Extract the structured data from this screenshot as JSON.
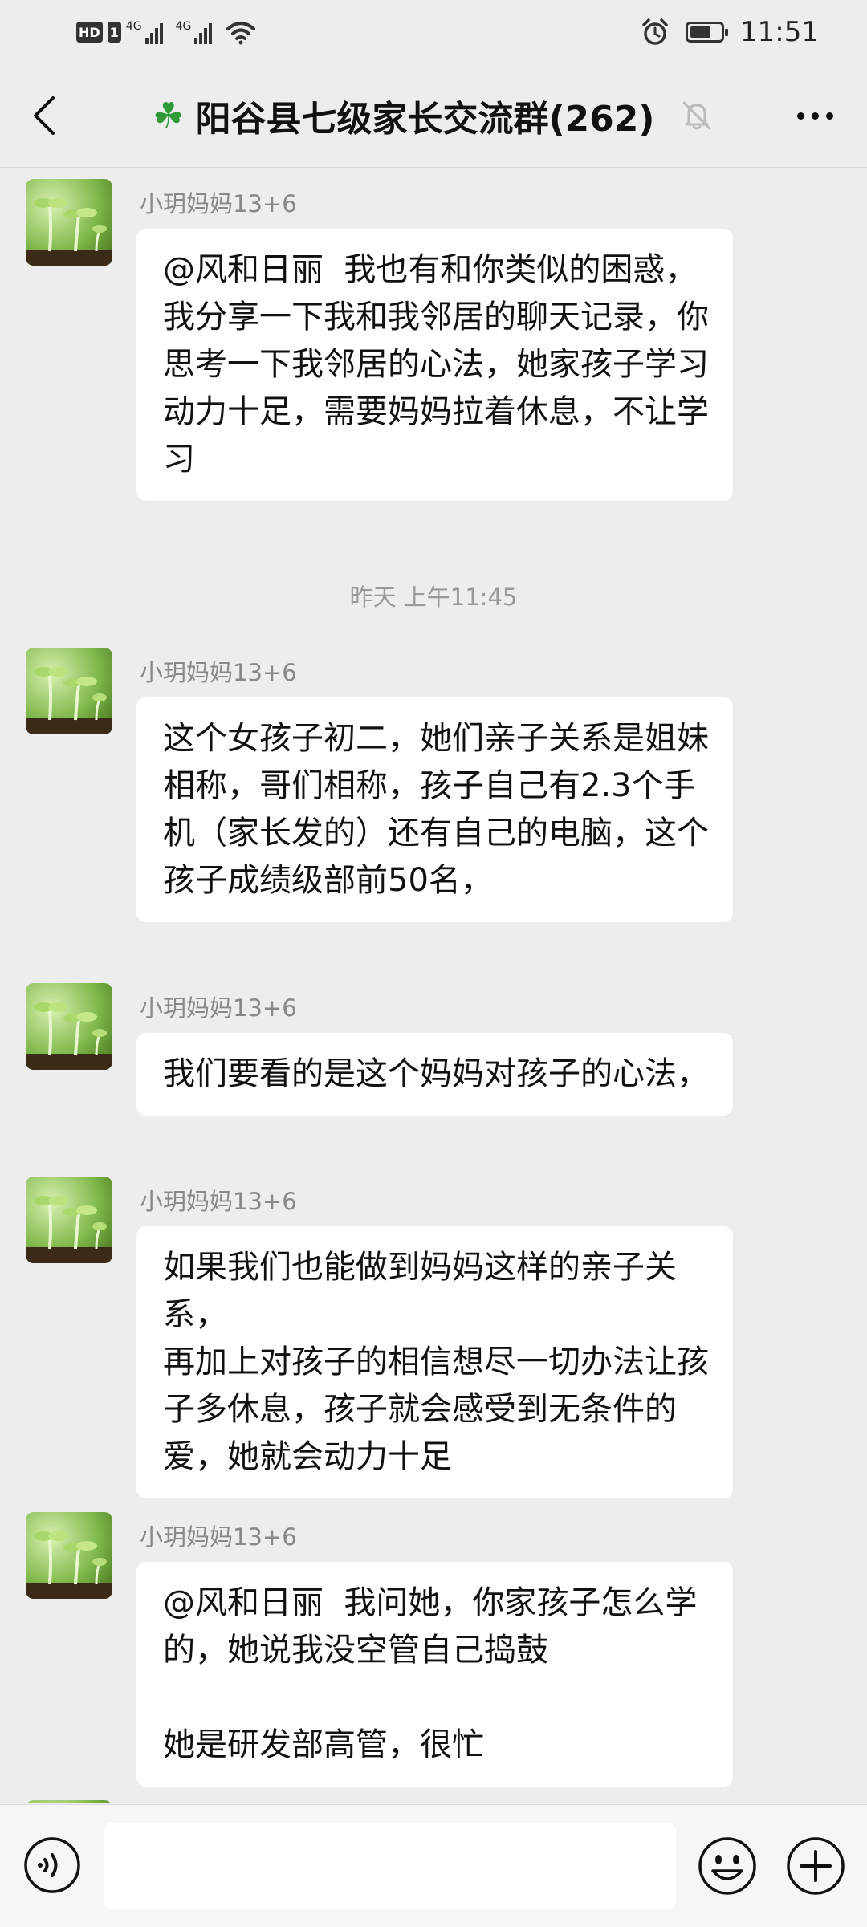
{
  "status_bar": {
    "hd": "HD",
    "sim": "1",
    "network_1": "4G",
    "network_2": "4G",
    "time": "11:51",
    "battery_level": 0.7,
    "icons": [
      "hd-icon",
      "signal-icon",
      "wifi-icon",
      "alarm-icon",
      "battery-icon"
    ]
  },
  "header": {
    "title": "阳谷县七级家长交流群(262)",
    "title_icon": "clover-icon",
    "muted": true
  },
  "messages": [
    {
      "sender": "小玥妈妈13+6",
      "text": "@风和日丽  我也有和你类似的困惑，\n我分享一下我和我邻居的聊天记录，你思考一下我邻居的心法，她家孩子学习动力十足，需要妈妈拉着休息，不让学习"
    },
    {
      "sender": "小玥妈妈13+6",
      "text": "这个女孩子初二，她们亲子关系是姐妹相称，哥们相称，孩子自己有2.3个手机（家长发的）还有自己的电脑，这个孩子成绩级部前50名，"
    },
    {
      "sender": "小玥妈妈13+6",
      "text": "我们要看的是这个妈妈对孩子的心法，"
    },
    {
      "sender": "小玥妈妈13+6",
      "text": "如果我们也能做到妈妈这样的亲子关系，\n再加上对孩子的相信想尽一切办法让孩子多休息，孩子就会感受到无条件的爱，她就会动力十足"
    },
    {
      "sender": "小玥妈妈13+6",
      "text": "@风和日丽  我问她，你家孩子怎么学的，她说我没空管自己捣鼓\n\n她是研发部高管，很忙"
    }
  ],
  "timestamp": "昨天 上午11:45",
  "input_bar": {
    "placeholder": "",
    "value": ""
  }
}
